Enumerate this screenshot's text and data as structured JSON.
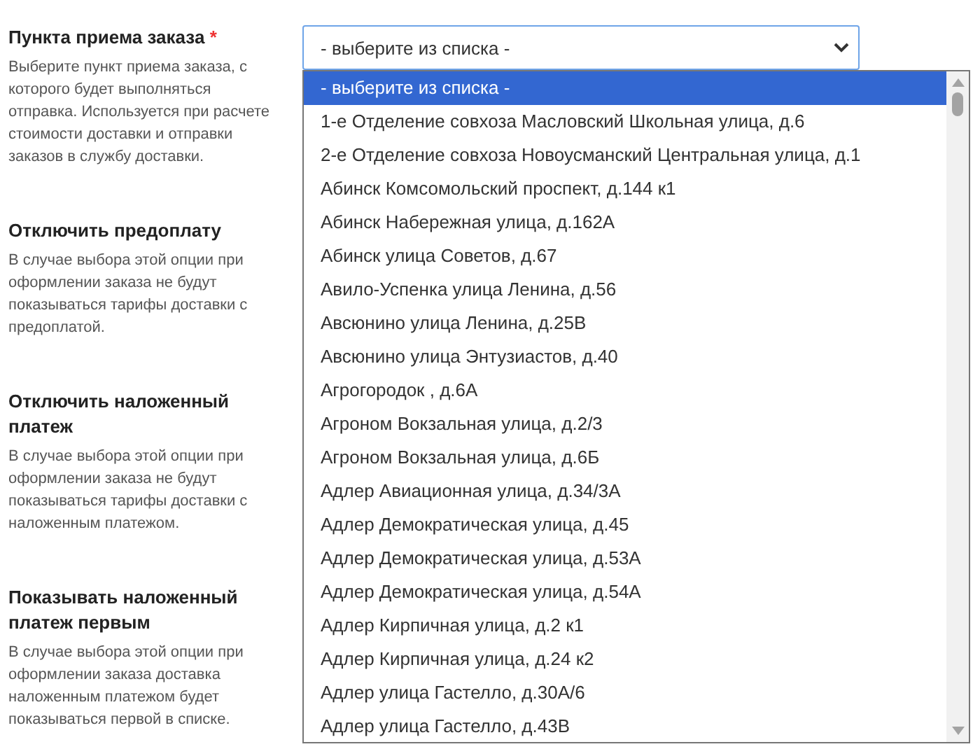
{
  "settings": [
    {
      "title": "Пункта приема заказа",
      "required_mark": "*",
      "description": "Выберите пункт приема заказа, с которого будет выполняться отправка. Используется при расчете стоимости доставки и отправки заказов в службу доставки."
    },
    {
      "title": "Отключить предоплату",
      "description": "В случае выбора этой опции при оформлении заказа не будут показываться тарифы доставки с предоплатой."
    },
    {
      "title": "Отключить наложенный платеж",
      "description": "В случае выбора этой опции при оформлении заказа не будут показываться тарифы доставки с наложенным платежом."
    },
    {
      "title": "Показывать наложенный платеж первым",
      "description": "В случае выбора этой опции при оформлении заказа доставка наложенным платежом будет показываться первой в списке."
    }
  ],
  "select": {
    "value": "- выберите из списка -",
    "expanded": true,
    "options": [
      {
        "label": "- выберите из списка -",
        "selected": true
      },
      {
        "label": "1-е Отделение совхоза Масловский Школьная улица, д.6",
        "selected": false
      },
      {
        "label": "2-е Отделение совхоза Новоусманский Центральная улица, д.1",
        "selected": false
      },
      {
        "label": "Абинск Комсомольский проспект, д.144 к1",
        "selected": false
      },
      {
        "label": "Абинск Набережная улица, д.162А",
        "selected": false
      },
      {
        "label": "Абинск улица Советов, д.67",
        "selected": false
      },
      {
        "label": "Авило-Успенка улица Ленина, д.56",
        "selected": false
      },
      {
        "label": "Авсюнино улица Ленина, д.25В",
        "selected": false
      },
      {
        "label": "Авсюнино улица Энтузиастов, д.40",
        "selected": false
      },
      {
        "label": "Агрогородок , д.6А",
        "selected": false
      },
      {
        "label": "Агроном Вокзальная улица, д.2/3",
        "selected": false
      },
      {
        "label": "Агроном Вокзальная улица, д.6Б",
        "selected": false
      },
      {
        "label": "Адлер Авиационная улица, д.34/3А",
        "selected": false
      },
      {
        "label": "Адлер Демократическая улица, д.45",
        "selected": false
      },
      {
        "label": "Адлер Демократическая улица, д.53А",
        "selected": false
      },
      {
        "label": "Адлер Демократическая улица, д.54А",
        "selected": false
      },
      {
        "label": "Адлер Кирпичная улица, д.2 к1",
        "selected": false
      },
      {
        "label": "Адлер Кирпичная улица, д.24 к2",
        "selected": false
      },
      {
        "label": "Адлер улица Гастелло, д.30А/6",
        "selected": false
      },
      {
        "label": "Адлер улица Гастелло, д.43В",
        "selected": false
      }
    ]
  }
}
